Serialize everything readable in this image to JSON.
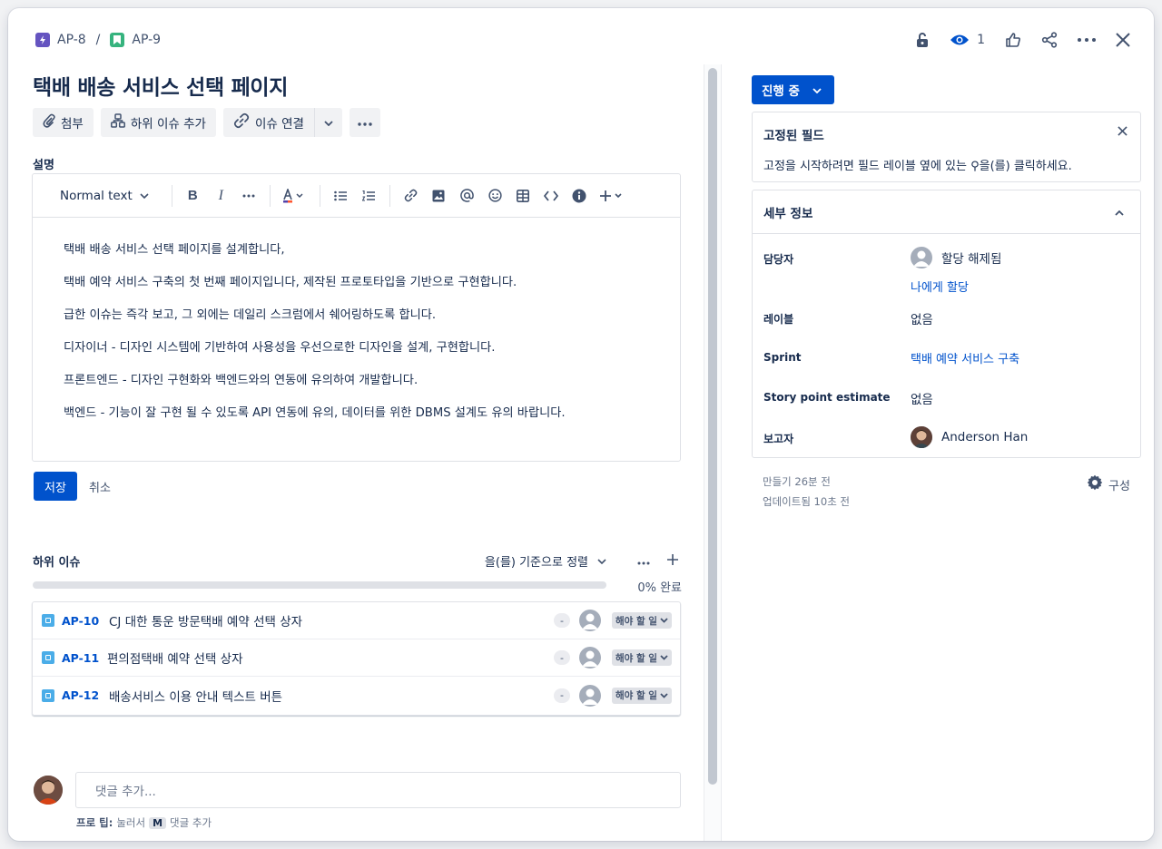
{
  "breadcrumb": {
    "parent_key": "AP-8",
    "separator": "/",
    "current_key": "AP-9",
    "parent_icon_color": "#6554c0",
    "current_icon_color": "#36b37e"
  },
  "top_actions": {
    "watchers_count": "1",
    "icons": [
      "lock-icon",
      "eye-icon",
      "thumbs-up-icon",
      "share-icon",
      "more-icon",
      "close-icon"
    ]
  },
  "issue": {
    "title": "택배 배송 서비스 선택 페이지"
  },
  "action_buttons": {
    "attach": "첨부",
    "add_child": "하위 이슈 추가",
    "link_issue": "이슈 연결"
  },
  "description": {
    "label": "설명",
    "toolbar_text_style": "Normal text",
    "paragraphs": [
      "택배 배송 서비스 선택 페이지를 설계합니다,",
      "택배 예약 서비스 구축의 첫 번째 페이지입니다, 제작된 프로토타입을 기반으로 구현합니다.",
      "급한 이슈는 즉각 보고, 그 외에는 데일리 스크럼에서 쉐어링하도록 합니다.",
      "디자이너 - 디자인 시스템에 기반하여 사용성을 우선으로한 디자인을 설계, 구현합니다.",
      "프론트엔드 - 디자인 구현화와 백엔드와의 연동에 유의하여 개발합니다.",
      "백엔드 - 기능이 잘 구현 될 수 있도록 API 연동에 유의, 데이터를 위한 DBMS 설계도 유의 바랍니다."
    ],
    "save_label": "저장",
    "cancel_label": "취소"
  },
  "child_issues": {
    "heading": "하위 이슈",
    "sort_label": "을(를) 기준으로 정렬",
    "progress_label": "0% 완료",
    "progress_fraction": 0,
    "items": [
      {
        "key": "AP-10",
        "summary": "CJ 대한 통운 방문택배 예약 선택 상자",
        "priority": "-",
        "status": "해야 할 일"
      },
      {
        "key": "AP-11",
        "summary": "편의점택배 예약 선택 상자",
        "priority": "-",
        "status": "해야 할 일"
      },
      {
        "key": "AP-12",
        "summary": "배송서비스 이용 안내 텍스트 버튼",
        "priority": "-",
        "status": "해야 할 일"
      }
    ]
  },
  "comments": {
    "placeholder": "댓글 추가...",
    "protip_bold": "프로 팁:",
    "protip_pre": "눌러서",
    "protip_key": "M",
    "protip_post": "댓글 추가"
  },
  "sidebar": {
    "status": "진행 중",
    "pinned": {
      "title": "고정된 필드",
      "text": "고정을 시작하려면 필드 레이블 옆에 있는 ⚲을(를) 클릭하세요."
    },
    "details": {
      "title": "세부 정보",
      "assignee_label": "담당자",
      "assignee_value": "할당 해제됨",
      "assign_to_me": "나에게 할당",
      "labels_label": "레이블",
      "labels_value": "없음",
      "sprint_label": "Sprint",
      "sprint_value": "택배 예약 서비스 구축",
      "story_point_label": "Story point estimate",
      "story_point_value": "없음",
      "reporter_label": "보고자",
      "reporter_value": "Anderson Han"
    },
    "created": "만들기 26분 전",
    "updated": "업데이트됨 10초 전",
    "configure": "구성"
  }
}
